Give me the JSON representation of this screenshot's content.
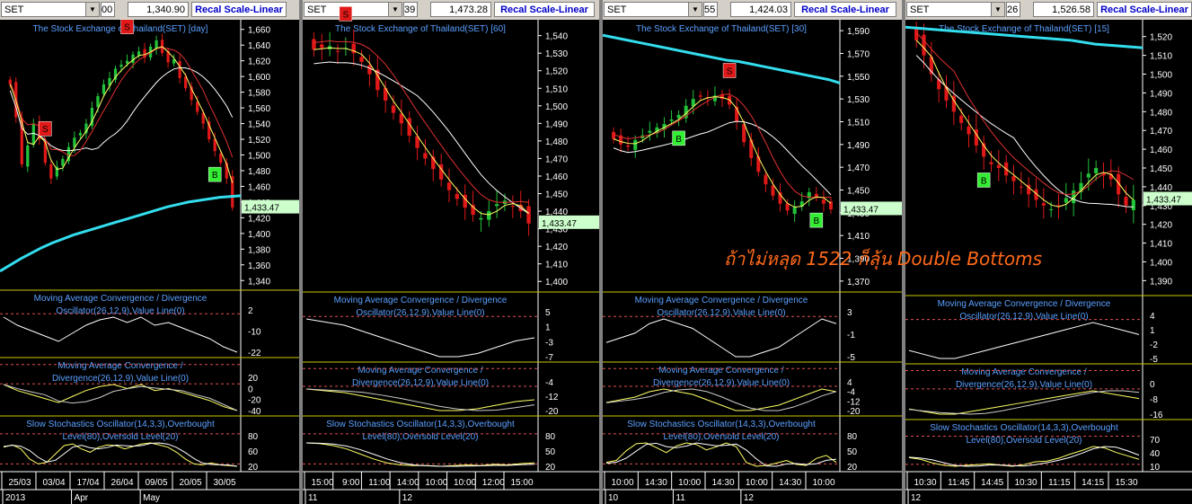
{
  "panels": [
    {
      "symbol": "SET",
      "toolbar_value_left": "00",
      "toolbar_price": "1,340.90",
      "recal": "Recal Scale-Linear",
      "title": "The Stock Exchange of Thailand(SET) [day]",
      "price_ticks": [
        "1,660",
        "1,640",
        "1,620",
        "1,600",
        "1,580",
        "1,560",
        "1,540",
        "1,520",
        "1,500",
        "1,480",
        "1,460",
        "1,440",
        "1,420",
        "1,400",
        "1,380",
        "1,360",
        "1,340"
      ],
      "price_tag": "1,433.47",
      "signals": [
        {
          "label": "S",
          "kind": "sell"
        },
        {
          "label": "S",
          "kind": "sell"
        },
        {
          "label": "B",
          "kind": "buy"
        }
      ],
      "macd1": {
        "title": "Moving Average Convergence / Divergence",
        "sub": "Oscillator(26,12,9),Value Line(0)",
        "ticks": [
          "2",
          "-10",
          "-22"
        ]
      },
      "macd2": {
        "title": "Moving Average Convergence /",
        "sub": "Divergence(26,12,9),Value Line(0)",
        "ticks": [
          "20",
          "0",
          "-20",
          "-40"
        ]
      },
      "stoch": {
        "title": "Slow Stochastics Oscillator(14,3,3),Overbought",
        "sub": "Level(80),Oversold Level(20)",
        "ticks": [
          "80",
          "60",
          "20"
        ]
      },
      "dates": [
        "25/03",
        "03/04",
        "17/04",
        "26/04",
        "09/05",
        "20/05",
        "30/05"
      ],
      "months": [
        "2013",
        "Apr",
        "May"
      ]
    },
    {
      "symbol": "SET",
      "toolbar_value_left": "39",
      "toolbar_price": "1,473.28",
      "recal": "Recal Scale-Linear",
      "title": "The Stock Exchange of Thailand(SET) [60]",
      "price_ticks": [
        "1,540",
        "1,530",
        "1,520",
        "1,510",
        "1,500",
        "1,490",
        "1,480",
        "1,470",
        "1,460",
        "1,450",
        "1,440",
        "1,430",
        "1,420",
        "1,410",
        "1,400"
      ],
      "price_tag": "1,433.47",
      "signals": [
        {
          "label": "S",
          "kind": "sell"
        }
      ],
      "macd1": {
        "title": "Moving Average Convergence / Divergence",
        "sub": "Oscillator(26,12,9),Value Line(0)",
        "ticks": [
          "5",
          "1",
          "-3",
          "-7"
        ]
      },
      "macd2": {
        "title": "Moving Average Convergence /",
        "sub": "Divergence(26,12,9),Value Line(0)",
        "ticks": [
          "-4",
          "-12",
          "-20"
        ]
      },
      "stoch": {
        "title": "Slow Stochastics Oscillator(14,3,3),Overbought",
        "sub": "Level(80),Oversold Level(20)",
        "ticks": [
          "80",
          "50",
          "20"
        ]
      },
      "dates": [
        "15:00",
        "9:00",
        "11:00",
        "14:00",
        "10:00",
        "10:00",
        "12:00",
        "15:00"
      ],
      "months": [
        "11",
        "12"
      ]
    },
    {
      "symbol": "SET",
      "toolbar_value_left": "55",
      "toolbar_price": "1,424.03",
      "recal": "Recal Scale-Linear",
      "title": "The Stock Exchange of Thailand(SET) [30]",
      "price_ticks": [
        "1,590",
        "1,570",
        "1,550",
        "1,530",
        "1,510",
        "1,490",
        "1,470",
        "1,450",
        "1,430",
        "1,410",
        "1,390",
        "1,370"
      ],
      "price_tag": "1,433.47",
      "signals": [
        {
          "label": "B",
          "kind": "buy"
        },
        {
          "label": "S",
          "kind": "sell"
        },
        {
          "label": "B",
          "kind": "buy"
        }
      ],
      "macd1": {
        "title": "Moving Average Convergence / Divergence",
        "sub": "Oscillator(26,12,9),Value Line(0)",
        "ticks": [
          "3",
          "-1",
          "-5"
        ]
      },
      "macd2": {
        "title": "Moving Average Convergence /",
        "sub": "Divergence(26,12,9),Value Line(0)",
        "ticks": [
          "4",
          "-4",
          "-12",
          "-20"
        ]
      },
      "stoch": {
        "title": "Slow Stochastics Oscillator(14,3,3),Overbought",
        "sub": "Level(80),Oversold Level(20)",
        "ticks": [
          "80",
          "50",
          "20"
        ]
      },
      "dates": [
        "10:00",
        "14:30",
        "10:00",
        "14:30",
        "10:00",
        "14:30",
        "10:00"
      ],
      "months": [
        "10",
        "11",
        "12"
      ]
    },
    {
      "symbol": "SET",
      "toolbar_value_left": "26",
      "toolbar_price": "1,526.58",
      "recal": "Recal Scale-Linear",
      "title": "The Stock Exchange of Thailand(SET) [15]",
      "price_ticks": [
        "1,520",
        "1,510",
        "1,500",
        "1,490",
        "1,480",
        "1,470",
        "1,460",
        "1,450",
        "1,440",
        "1,430",
        "1,420",
        "1,410",
        "1,400",
        "1,390"
      ],
      "price_tag": "1,433.47",
      "signals": [
        {
          "label": "B",
          "kind": "buy"
        }
      ],
      "macd1": {
        "title": "Moving Average Convergence / Divergence",
        "sub": "Oscillator(26,12,9),Value Line(0)",
        "ticks": [
          "4",
          "1",
          "-2",
          "-5"
        ]
      },
      "macd2": {
        "title": "Moving Average Convergence /",
        "sub": "Divergence(26,12,9),Value Line(0)",
        "ticks": [
          "0",
          "-8",
          "-16"
        ]
      },
      "stoch": {
        "title": "Slow Stochastics Oscillator(14,3,3),Overbought",
        "sub": "Level(80),Oversold Level(20)",
        "ticks": [
          "70",
          "40",
          "10"
        ]
      },
      "dates": [
        "10:30",
        "11:45",
        "14:45",
        "10:30",
        "11:15",
        "14:15",
        "15:30"
      ],
      "months": [
        "12"
      ]
    }
  ],
  "annotation": "ถ้าไม่หลุด 1522 ก็ลุ้น Double Bottoms",
  "colors": {
    "up": "#22c43a",
    "down": "#e01818",
    "ma_short": "#ffff66",
    "ma_mid": "#e03030",
    "ma_long": "#ffffff",
    "ma_trend": "#33ddee",
    "title": "#5aa0ff",
    "axis_text": "#ffffff",
    "divider": "#c8c800",
    "reference": "#e05050",
    "price_tag_bg": "#ccffcc",
    "sell": "#e01818",
    "buy": "#33ee33"
  },
  "chart_data": [
    {
      "type": "candlestick",
      "timeframe": "day",
      "ylim": [
        1330,
        1670
      ],
      "close": [
        1590,
        1548,
        1488,
        1512,
        1540,
        1520,
        1490,
        1470,
        1485,
        1495,
        1510,
        1522,
        1528,
        1540,
        1560,
        1575,
        1590,
        1598,
        1610,
        1615,
        1620,
        1628,
        1632,
        1624,
        1638,
        1646,
        1630,
        1618,
        1622,
        1598,
        1585,
        1570,
        1555,
        1540,
        1520,
        1505,
        1490,
        1470,
        1433
      ],
      "ma_trend": [
        1352,
        1360,
        1368,
        1375,
        1382,
        1388,
        1393,
        1398,
        1402,
        1406,
        1410,
        1414,
        1418,
        1422,
        1426,
        1430,
        1434,
        1437,
        1440,
        1442,
        1444,
        1446,
        1447,
        1448
      ],
      "stoch": [
        75,
        82,
        70,
        40,
        25,
        30,
        55,
        80,
        85,
        70,
        60,
        75,
        82,
        80,
        70,
        78,
        85,
        88,
        82,
        75,
        60,
        40,
        25,
        22,
        28,
        22,
        20,
        18
      ],
      "macd": [
        2,
        -4,
        -8,
        -12,
        -16,
        -10,
        -4,
        0,
        2,
        -2,
        2,
        -4,
        -2,
        -6,
        -10,
        -14,
        -20,
        -24
      ]
    },
    {
      "type": "candlestick",
      "timeframe": "60",
      "ylim": [
        1395,
        1548
      ],
      "close": [
        1532,
        1533,
        1534,
        1531,
        1533,
        1530,
        1525,
        1518,
        1509,
        1503,
        1496,
        1490,
        1483,
        1476,
        1470,
        1464,
        1458,
        1452,
        1447,
        1442,
        1438,
        1436,
        1440,
        1444,
        1446,
        1443,
        1440,
        1433
      ],
      "stoch": [
        88,
        86,
        80,
        70,
        55,
        40,
        28,
        22,
        20,
        20,
        18,
        20,
        22,
        20,
        24,
        22,
        26,
        28
      ],
      "macd": [
        5,
        4,
        3,
        1,
        -1,
        -3,
        -5,
        -7,
        -7,
        -6,
        -4,
        -2,
        -1
      ]
    },
    {
      "type": "candlestick",
      "timeframe": "30",
      "ylim": [
        1362,
        1598
      ],
      "close": [
        1495,
        1490,
        1488,
        1494,
        1498,
        1502,
        1505,
        1508,
        1512,
        1516,
        1524,
        1530,
        1532,
        1531,
        1533,
        1530,
        1525,
        1510,
        1492,
        1478,
        1466,
        1455,
        1445,
        1438,
        1432,
        1435,
        1440,
        1448,
        1444,
        1438,
        1433
      ],
      "ma_trend": [
        1586,
        1584,
        1582,
        1580,
        1578,
        1576,
        1574,
        1572,
        1570,
        1568,
        1566,
        1564,
        1563,
        1561,
        1559,
        1557,
        1555,
        1553,
        1551,
        1549,
        1547,
        1544
      ],
      "stoch": [
        30,
        35,
        60,
        78,
        80,
        68,
        55,
        72,
        80,
        76,
        62,
        70,
        80,
        70,
        30,
        20,
        22,
        28,
        35,
        25,
        22,
        40,
        48,
        30
      ],
      "macd": [
        -2,
        -1,
        0,
        2,
        3,
        2,
        1,
        -1,
        -3,
        -5,
        -5,
        -4,
        -3,
        -1,
        1,
        3,
        2
      ]
    },
    {
      "type": "candlestick",
      "timeframe": "15",
      "ylim": [
        1383,
        1528
      ],
      "close": [
        1518,
        1510,
        1500,
        1492,
        1486,
        1480,
        1474,
        1468,
        1462,
        1456,
        1452,
        1450,
        1446,
        1443,
        1440,
        1436,
        1433,
        1430,
        1428,
        1430,
        1434,
        1438,
        1442,
        1447,
        1450,
        1446,
        1444,
        1436,
        1430,
        1433
      ],
      "ma_trend": [
        1525,
        1524,
        1523,
        1522,
        1521,
        1520,
        1519,
        1518,
        1516,
        1515,
        1514
      ],
      "stoch": [
        40,
        35,
        25,
        18,
        15,
        18,
        20,
        22,
        18,
        15,
        20,
        28,
        30,
        38,
        50,
        60,
        72,
        68,
        55,
        45,
        35
      ],
      "macd": [
        -3,
        -4,
        -5,
        -5,
        -4,
        -3,
        -2,
        -1,
        0,
        1,
        2,
        3,
        4,
        3,
        2,
        1
      ]
    }
  ]
}
